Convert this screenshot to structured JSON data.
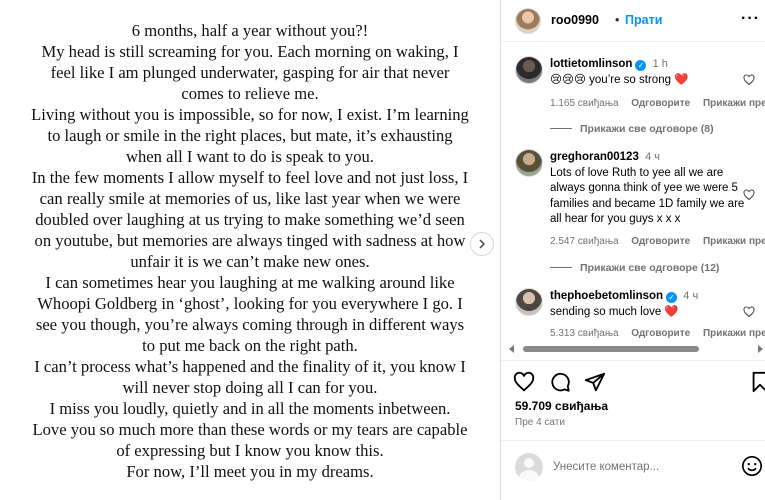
{
  "post": {
    "lines": [
      "6 months, half a year without you?!",
      "My head is still screaming for you. Each morning on waking, I",
      "feel like I am plunged underwater, gasping for air that never",
      "comes to relieve me.",
      "Living without you is impossible, so for now, I exist. I’m learning",
      "to laugh or smile in the right places, but mate, it’s exhausting",
      "when all I want to do is speak to you.",
      "In the few moments I allow myself to feel love and not just loss, I",
      "can really smile at memories of us, like last year when we were",
      "doubled over laughing at us trying to make something we’d seen",
      "on youtube, but memories are always tinged with sadness at how",
      "unfair it is we can’t make new ones.",
      "I can sometimes hear you laughing at me walking around like",
      "Whoopi Goldberg in ‘ghost’, looking for you everywhere I go. I",
      "see you though, you’re always coming through in different ways",
      "to put me back on the right path.",
      "I can’t process what’s happened and the finality of it, you know I",
      "will never stop doing all I can for you.",
      "I miss you loudly, quietly and in all the moments inbetween.",
      "Love you so much more than these words or my tears are capable",
      "of expressing but I know you know this.",
      "For now, I’ll meet you in my dreams."
    ]
  },
  "header": {
    "username": "roo0990",
    "separator": "•",
    "follow_label": "Прати",
    "more_label": "···"
  },
  "comments": [
    {
      "username": "lottietomlinson",
      "verified": true,
      "time": "1 h",
      "text": "😢😢😢 you’re so strong ❤️",
      "likes": "1.165 свиђања",
      "reply": "Одговорите",
      "translate": "Прикажи преводе",
      "view_replies": "Прикажи све одговоре (8)"
    },
    {
      "username": "greghoran00123",
      "verified": false,
      "time": "4 ч",
      "text": "Lots of love Ruth to yee all we are always gonna think of yee we were 5 families and became 1D family we are all hear for you guys x x x",
      "likes": "2.547 свиђања",
      "reply": "Одговорите",
      "translate": "Прикажи преводе",
      "view_replies": "Прикажи све одговоре (12)"
    },
    {
      "username": "thephoebetomlinson",
      "verified": true,
      "time": "4 ч",
      "text": "sending so much love ❤️",
      "likes": "5.313 свиђања",
      "reply": "Одговорите",
      "translate": "Прикажи преводе"
    }
  ],
  "footer": {
    "likes": "59.709 свиђања",
    "posted": "Пре 4 сати",
    "comment_placeholder": "Унесите коментар..."
  },
  "colors": {
    "accent": "#0095f6",
    "heart": "#ed4956",
    "muted": "#737373"
  }
}
